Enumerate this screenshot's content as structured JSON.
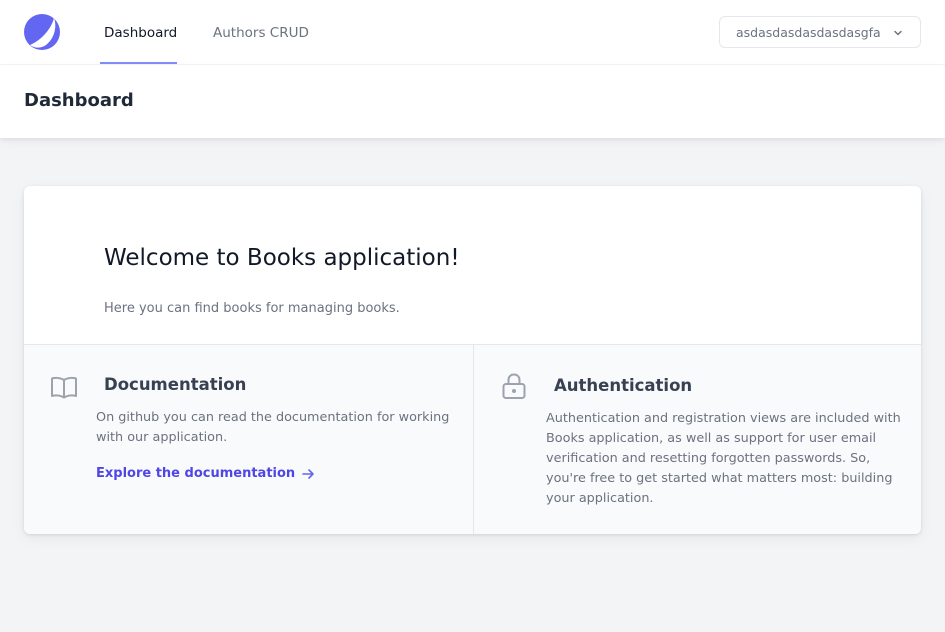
{
  "nav": {
    "logo_icon": "logo-crescent-icon",
    "links": [
      {
        "label": "Dashboard",
        "active": true
      },
      {
        "label": "Authors CRUD",
        "active": false
      }
    ],
    "user_name": "asdasdasdasdasdasgfa",
    "accent_color": "#818cf8"
  },
  "header": {
    "title": "Dashboard"
  },
  "welcome": {
    "title": "Welcome to Books application!",
    "subtitle": "Here you can find books for managing books."
  },
  "features": [
    {
      "icon": "book-open-icon",
      "title": "Documentation",
      "text_lines": [
        "On github you can read the documentation for working",
        "with our application."
      ],
      "link_label": "Explore the documentation"
    },
    {
      "icon": "lock-icon",
      "title": "Authentication",
      "text_lines": [
        "Authentication and registration views are included with",
        "Books application, as well as support for user email",
        "verification and resetting forgotten passwords. So,",
        "you're free to get started what matters most: building",
        "your application."
      ]
    }
  ],
  "colors": {
    "link": "#4f46e5",
    "logo": "#6366f1",
    "background": "#f3f4f6"
  }
}
